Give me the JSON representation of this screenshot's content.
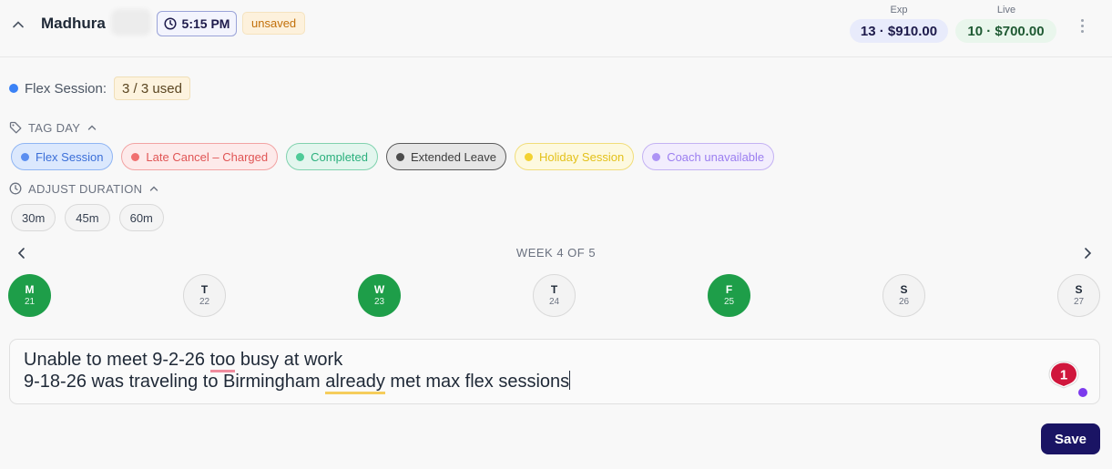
{
  "header": {
    "client_name": "Madhura",
    "time": "5:15 PM",
    "status_badge": "unsaved",
    "exp_label": "Exp",
    "exp_value": "13 · $910.00",
    "live_label": "Live",
    "live_value": "10 · $700.00"
  },
  "flex": {
    "label": "Flex Session:",
    "used": "3 / 3 used"
  },
  "tag_day": {
    "heading": "TAG DAY",
    "tags": [
      {
        "label": "Flex Session",
        "color": "#3b82f6"
      },
      {
        "label": "Late Cancel – Charged",
        "color": "#ef4444"
      },
      {
        "label": "Completed",
        "color": "#34c38f"
      },
      {
        "label": "Extended Leave",
        "color": "#4b4b4b"
      },
      {
        "label": "Holiday Session",
        "color": "#eab308"
      },
      {
        "label": "Coach unavailable",
        "color": "#a78bfa"
      }
    ]
  },
  "duration": {
    "heading": "ADJUST DURATION",
    "options": [
      "30m",
      "45m",
      "60m"
    ]
  },
  "week": {
    "label": "WEEK 4 OF 5",
    "days": [
      {
        "letter": "M",
        "num": "21",
        "selected": true
      },
      {
        "letter": "T",
        "num": "22",
        "selected": false
      },
      {
        "letter": "W",
        "num": "23",
        "selected": true
      },
      {
        "letter": "T",
        "num": "24",
        "selected": false
      },
      {
        "letter": "F",
        "num": "25",
        "selected": true
      },
      {
        "letter": "S",
        "num": "26",
        "selected": false
      },
      {
        "letter": "S",
        "num": "27",
        "selected": false
      }
    ]
  },
  "note": {
    "line1_a": "Unable to meet 9-2-26 ",
    "line1_spell": "too",
    "line1_b": " busy at work",
    "line2_a": "9-18-26 was traveling to Birmingham ",
    "line2_grammar": "already",
    "line2_b": " met max flex sessions"
  },
  "grammarly_count": "1",
  "actions": {
    "save": "Save"
  },
  "colors": {
    "accent": "#1a1464",
    "selected_day": "#1e9e49"
  }
}
